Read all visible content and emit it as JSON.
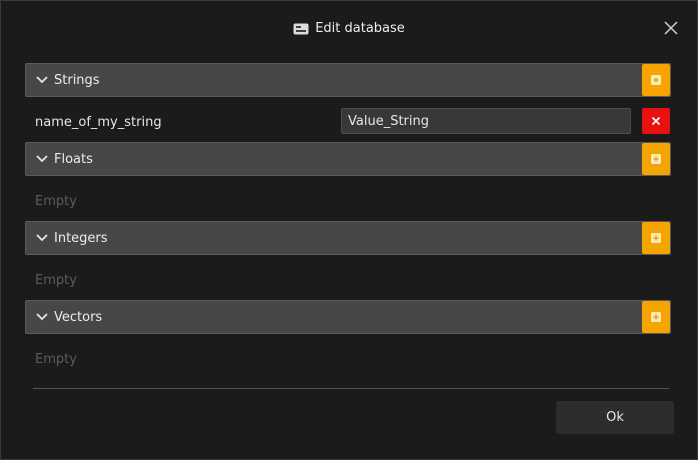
{
  "dialog": {
    "title": "Edit database",
    "icon": "database-icon",
    "close_icon": "close-icon"
  },
  "sections": {
    "strings": {
      "label": "Strings",
      "rows": [
        {
          "name": "name_of_my_string",
          "value": "Value_String"
        }
      ]
    },
    "floats": {
      "label": "Floats",
      "empty_text": "Empty"
    },
    "integers": {
      "label": "Integers",
      "empty_text": "Empty"
    },
    "vectors": {
      "label": "Vectors",
      "empty_text": "Empty"
    }
  },
  "footer": {
    "ok_label": "Ok"
  },
  "colors": {
    "accent_add": "#f5a400",
    "delete": "#e81010",
    "header_bg": "#474747",
    "dialog_bg": "#1b1b1b"
  }
}
